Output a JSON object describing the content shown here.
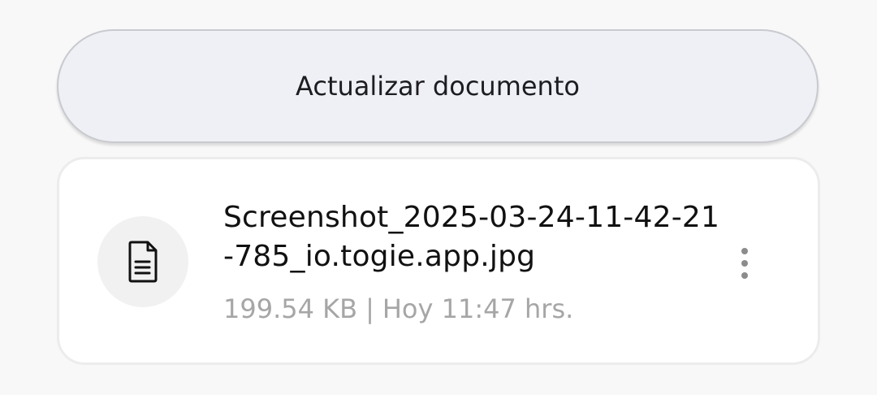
{
  "actions": {
    "update_label": "Actualizar documento"
  },
  "file": {
    "icon": "document-icon",
    "name": "Screenshot_2025-03-24-11-42-21-785_io.togie.app.jpg",
    "size": "199.54 KB",
    "separator": "|",
    "timestamp": "Hoy 11:47 hrs.",
    "menu_icon": "more-vertical-icon"
  }
}
